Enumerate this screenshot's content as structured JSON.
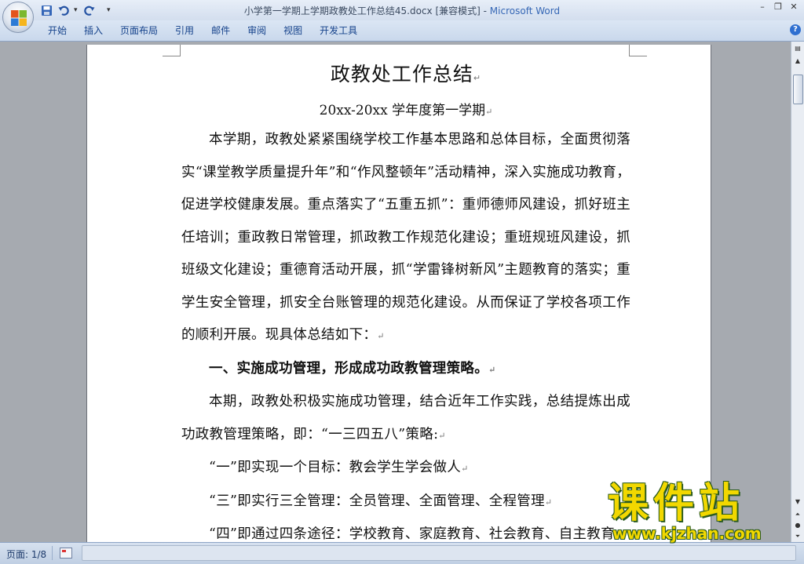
{
  "window": {
    "title": "小学第一学期上学期政教处工作总结45.docx [兼容模式]",
    "separator": " - ",
    "app_name": "Microsoft Word"
  },
  "quick_access": {
    "save_icon": "save-icon",
    "undo_icon": "undo-icon",
    "redo_icon": "redo-icon",
    "customize_icon": "customize-qat-icon"
  },
  "ribbon": {
    "tabs": [
      {
        "label": "开始"
      },
      {
        "label": "插入"
      },
      {
        "label": "页面布局"
      },
      {
        "label": "引用"
      },
      {
        "label": "邮件"
      },
      {
        "label": "审阅"
      },
      {
        "label": "视图"
      },
      {
        "label": "开发工具"
      }
    ],
    "help_symbol": "?"
  },
  "document": {
    "title": "政教处工作总结",
    "subtitle": "20xx-20xx 学年度第一学期",
    "paragraph_mark": "↵",
    "paragraphs": [
      {
        "text": "本学期，政教处紧紧围绕学校工作基本思路和总体目标，全面贯彻落实“课堂教学质量提升年”和“作风整顿年”活动精神，深入实施成功教育，促进学校健康发展。重点落实了“五重五抓”：重师德师风建设，抓好班主任培训；重政教日常管理，抓政教工作规范化建设；重班规班风建设，抓班级文化建设；重德育活动开展，抓“学雷锋树新风”主题教育的落实；重学生安全管理，抓安全台账管理的规范化建设。从而保证了学校各项工作的顺利开展。现具体总结如下："
      },
      {
        "text": "一、实施成功管理，形成成功政教管理策略。"
      },
      {
        "text": "本期，政教处积极实施成功管理，结合近年工作实践，总结提炼出成功政教管理策略，即：“一三四五八”策略:"
      },
      {
        "text": "“一”即实现一个目标：教会学生学会做人"
      },
      {
        "text": "“三”即实行三全管理：全员管理、全面管理、全程管理"
      },
      {
        "text": "“四”即通过四条途径：学校教育、家庭教育、社会教育、自主教育"
      }
    ]
  },
  "status_bar": {
    "page_info": "页面: 1/8",
    "proofing_icon": "proofing-icon"
  },
  "watermark": {
    "main": "课件站",
    "url": "www.kjzhan.com"
  }
}
